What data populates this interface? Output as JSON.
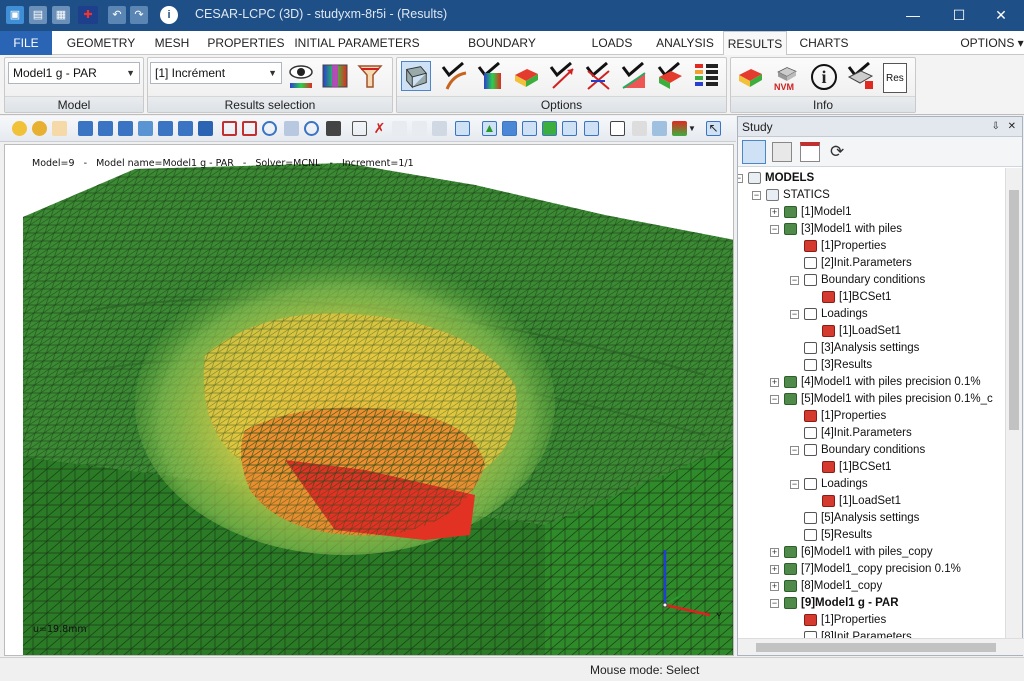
{
  "window": {
    "title": "CESAR-LCPC (3D) - studyxm-8r5i - (Results)",
    "quick_access": [
      "app-icon",
      "open-icon",
      "save-icon",
      "language-flag-icon",
      "undo-icon",
      "redo-icon",
      "info-icon"
    ],
    "controls": {
      "minimize": "—",
      "maximize": "☐",
      "close": "✕"
    }
  },
  "menu": {
    "file": "FILE",
    "tabs": [
      "GEOMETRY",
      "MESH",
      "PROPERTIES",
      "INITIAL PARAMETERS",
      "BOUNDARY CONDITIONS",
      "LOADS",
      "ANALYSIS",
      "RESULTS",
      "CHARTS"
    ],
    "active": "RESULTS",
    "options": "OPTIONS ▾"
  },
  "ribbon": {
    "model_group": {
      "label": "Model",
      "selected": "Model1 g - PAR"
    },
    "results_group": {
      "label": "Results selection",
      "selected": "[1] Incrément",
      "icons": [
        "eye-icon",
        "color-scale-icon",
        "deformation-icon"
      ]
    },
    "options_group": {
      "label": "Options",
      "icons": [
        "mesh-display-icon",
        "isovalue-line-icon",
        "color-fill-icon",
        "iso-surface-icon",
        "vector-icon",
        "principal-directions-icon",
        "curve-chart-icon",
        "section-plane-icon",
        "legend-icon"
      ]
    },
    "info_group": {
      "label": "Info",
      "icons": [
        "model-info-icon",
        "nvm-icon",
        "info-icon",
        "properties-info-icon",
        "res-icon"
      ],
      "res_text": "Res",
      "nvm_text": "NVM"
    }
  },
  "viewport": {
    "info": "Model=9   -   Model name=Model1 g - PAR   -   Solver=MCNL   -   Increment=1/1",
    "displacement": "u=19.8mm",
    "axes": {
      "y": "Y"
    },
    "colors": {
      "ground": "#2f7d2a",
      "mesh": "#1c3a1a",
      "high": "#e02a20",
      "mid": "#f0c83a"
    }
  },
  "study": {
    "title": "Study",
    "pin": "⇩",
    "close": "✕",
    "tools": [
      "tree-view-icon",
      "properties-view-icon",
      "calendar-icon",
      "refresh-icon"
    ],
    "tree": [
      {
        "label": "MODELS",
        "level": 0,
        "icon": "folder",
        "exp": "−",
        "bold": true
      },
      {
        "label": "STATICS",
        "level": 1,
        "icon": "folder",
        "exp": "−"
      },
      {
        "label": "[1]Model1",
        "level": 2,
        "icon": "model",
        "exp": "+"
      },
      {
        "label": "[3]Model1 with piles",
        "level": 2,
        "icon": "model",
        "exp": "−"
      },
      {
        "label": "[1]Properties",
        "level": 3,
        "icon": "prop"
      },
      {
        "label": "[2]Init.Parameters",
        "level": 3,
        "icon": "doc"
      },
      {
        "label": "Boundary conditions",
        "level": 3,
        "icon": "doc",
        "exp": "−"
      },
      {
        "label": "[1]BCSet1",
        "level": 4,
        "icon": "prop"
      },
      {
        "label": "Loadings",
        "level": 3,
        "icon": "doc",
        "exp": "−"
      },
      {
        "label": "[1]LoadSet1",
        "level": 4,
        "icon": "prop"
      },
      {
        "label": "[3]Analysis settings",
        "level": 3,
        "icon": "doc"
      },
      {
        "label": "[3]Results",
        "level": 3,
        "icon": "doc"
      },
      {
        "label": "[4]Model1 with piles precision 0.1%",
        "level": 2,
        "icon": "model",
        "exp": "+"
      },
      {
        "label": "[5]Model1 with piles precision 0.1%_c",
        "level": 2,
        "icon": "model",
        "exp": "−"
      },
      {
        "label": "[1]Properties",
        "level": 3,
        "icon": "prop"
      },
      {
        "label": "[4]Init.Parameters",
        "level": 3,
        "icon": "doc"
      },
      {
        "label": "Boundary conditions",
        "level": 3,
        "icon": "doc",
        "exp": "−"
      },
      {
        "label": "[1]BCSet1",
        "level": 4,
        "icon": "prop"
      },
      {
        "label": "Loadings",
        "level": 3,
        "icon": "doc",
        "exp": "−"
      },
      {
        "label": "[1]LoadSet1",
        "level": 4,
        "icon": "prop"
      },
      {
        "label": "[5]Analysis settings",
        "level": 3,
        "icon": "doc"
      },
      {
        "label": "[5]Results",
        "level": 3,
        "icon": "doc"
      },
      {
        "label": "[6]Model1 with piles_copy",
        "level": 2,
        "icon": "model",
        "exp": "+"
      },
      {
        "label": "[7]Model1_copy precision 0.1%",
        "level": 2,
        "icon": "model",
        "exp": "+"
      },
      {
        "label": "[8]Model1_copy",
        "level": 2,
        "icon": "model",
        "exp": "+"
      },
      {
        "label": "[9]Model1 g - PAR",
        "level": 2,
        "icon": "model",
        "exp": "−",
        "bold": true
      },
      {
        "label": "[1]Properties",
        "level": 3,
        "icon": "prop"
      },
      {
        "label": "[8]Init.Parameters",
        "level": 3,
        "icon": "doc"
      }
    ]
  },
  "status": {
    "text": "Mouse mode: Select"
  }
}
